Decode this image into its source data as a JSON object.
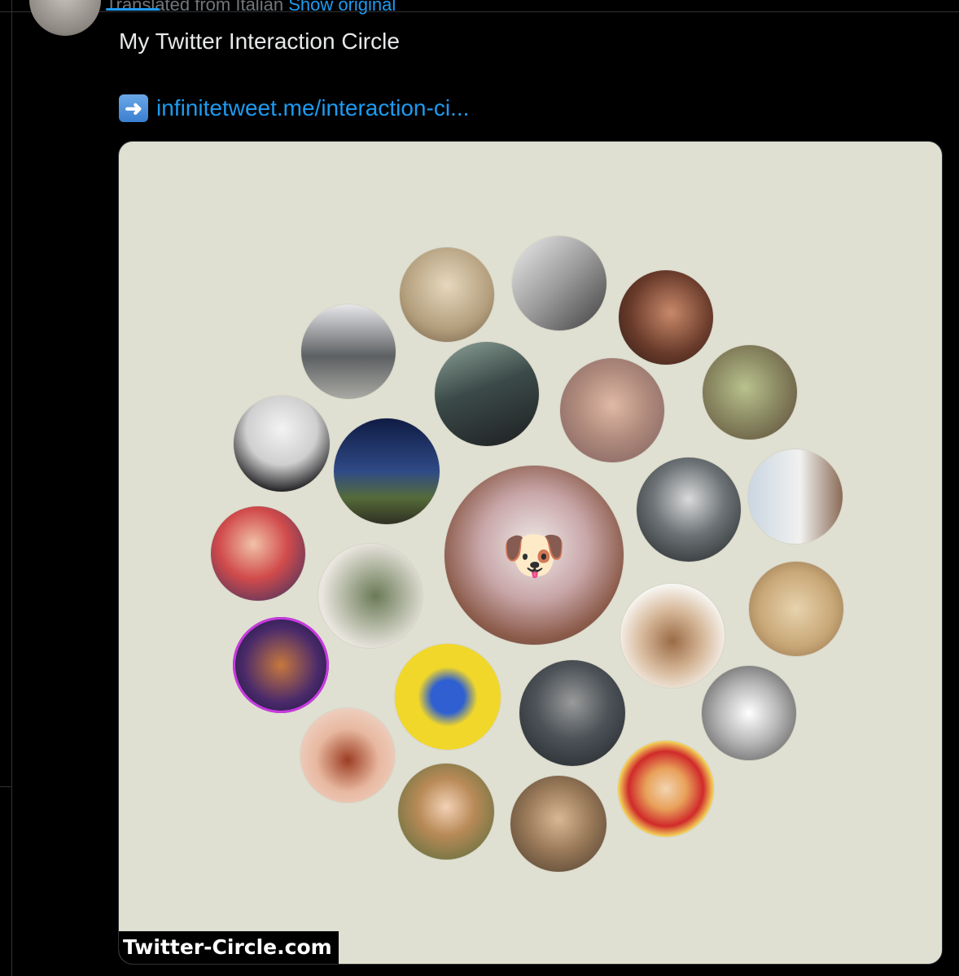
{
  "tweet": {
    "translated_label": "Translated from Italian",
    "show_original_label": "Show original",
    "text": "My Twitter Interaction Circle",
    "link_icon": "right-arrow-emoji",
    "link_text": "infinitetweet.me/interaction-ci..."
  },
  "media": {
    "watermark": "Twitter-Circle.com",
    "background_color": "#e0e0d2",
    "center_avatar": "dog-toy-avatar",
    "avatars": [
      "woman-sepia-portrait-avatar",
      "grayscale-mirror-selfie-avatar",
      "woman-dark-hair-avatar",
      "building-entrance-avatar",
      "balcony-silhouette-avatar",
      "man-glasses-avatar",
      "baby-yoda-avatar",
      "man-suit-avatar",
      "night-sky-hill-avatar",
      "gothic-cat-avatar",
      "girl-window-avatar",
      "gamer-headphones-avatar",
      "anubis-avatar",
      "we-the-people-avatar",
      "mammoth-plush-avatar",
      "bearded-king-cat-avatar",
      "origami-crane-avatar",
      "soldier-armor-avatar",
      "cracked-egg-sketch-avatar",
      "violin-avatar",
      "clown-sombrero-avatar",
      "smiling-woman-avatar",
      "lion-cubs-avatar"
    ]
  },
  "colors": {
    "link": "#1d9bf0",
    "text": "#e7e9ea",
    "muted": "#71767b"
  }
}
